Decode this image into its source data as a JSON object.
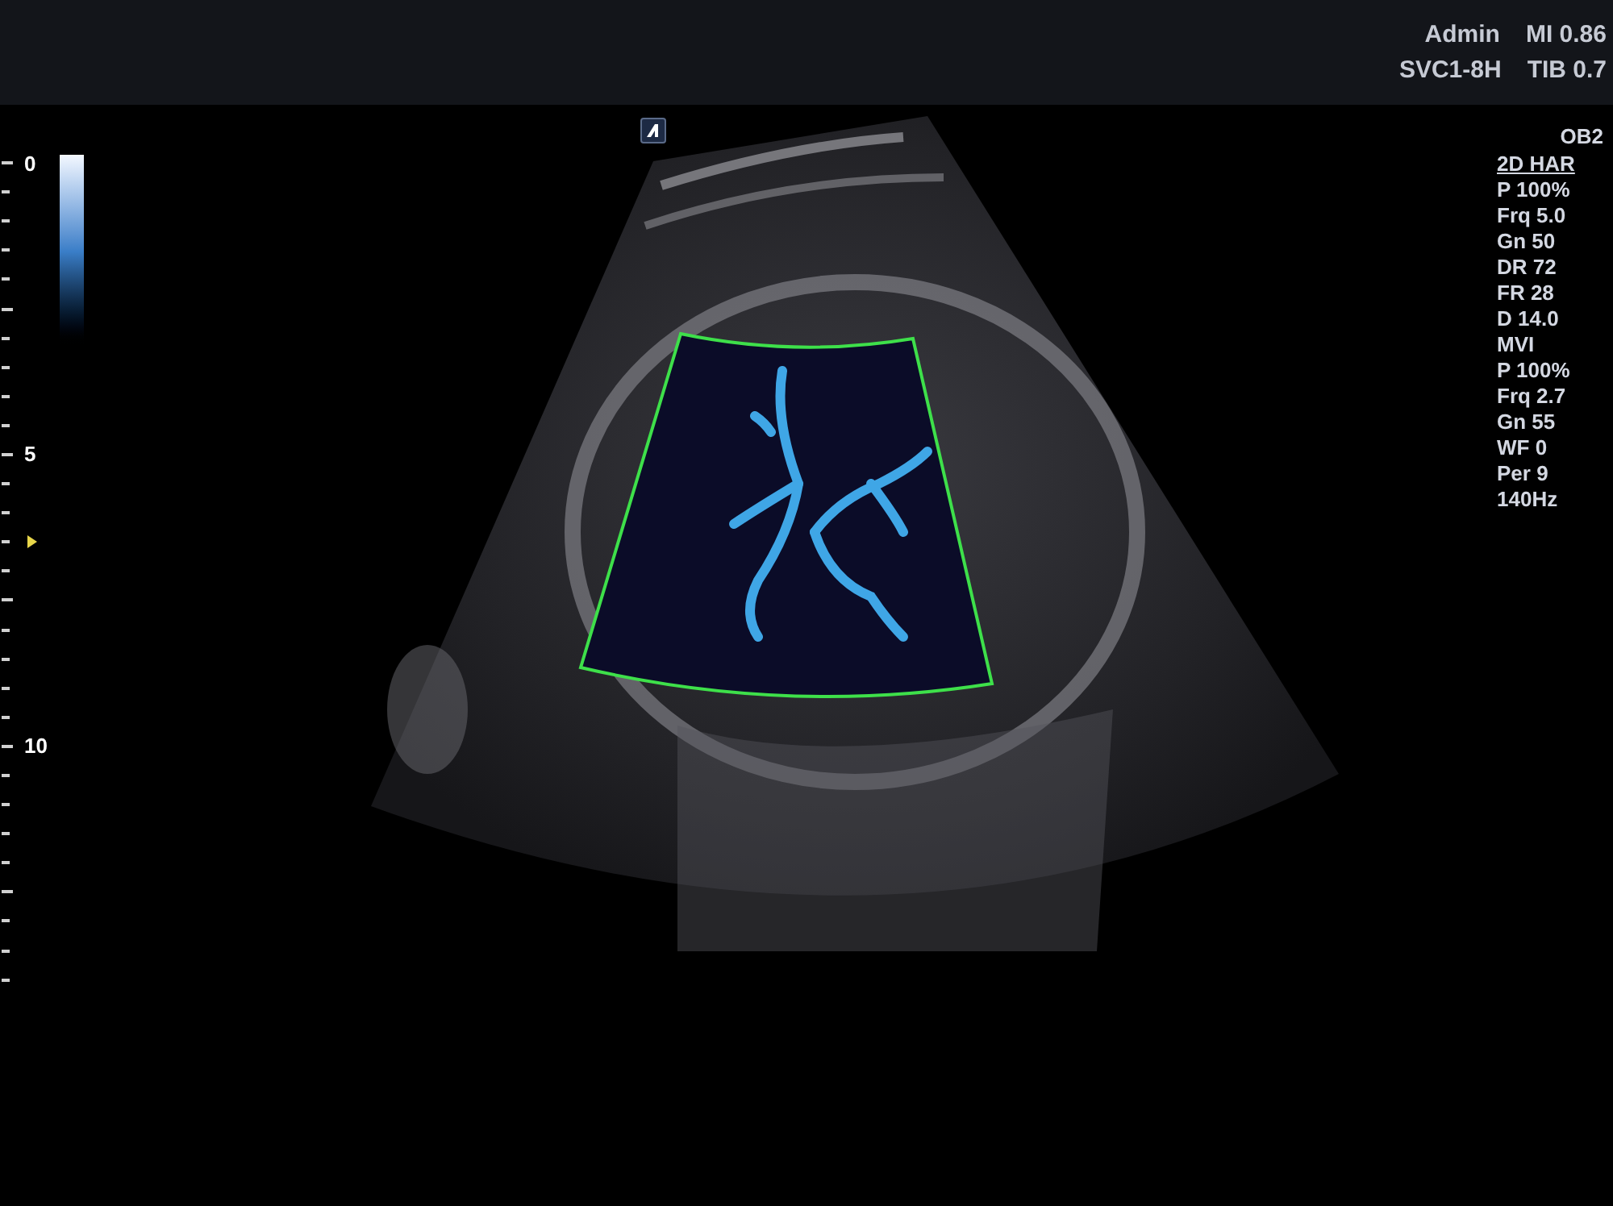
{
  "header": {
    "rows": [
      [
        "Admin",
        "MI 0.86"
      ],
      [
        "SVC1-8H",
        "TIB 0.7"
      ]
    ]
  },
  "depth_scale": {
    "labels": [
      "0",
      "5",
      "10"
    ]
  },
  "preset": "OB2",
  "parameters": [
    {
      "text": "2D HAR",
      "selected": true
    },
    {
      "text": "P 100%",
      "selected": false
    },
    {
      "text": "Frq 5.0",
      "selected": false
    },
    {
      "text": "Gn 50",
      "selected": false
    },
    {
      "text": "DR 72",
      "selected": false
    },
    {
      "text": "FR 28",
      "selected": false
    },
    {
      "text": "D 14.0",
      "selected": false
    },
    {
      "text": "MVI",
      "selected": false
    },
    {
      "text": "P 100%",
      "selected": false
    },
    {
      "text": "Frq 2.7",
      "selected": false
    },
    {
      "text": "Gn 55",
      "selected": false
    },
    {
      "text": "WF 0",
      "selected": false
    },
    {
      "text": "Per 9",
      "selected": false
    },
    {
      "text": "140Hz",
      "selected": false
    }
  ]
}
